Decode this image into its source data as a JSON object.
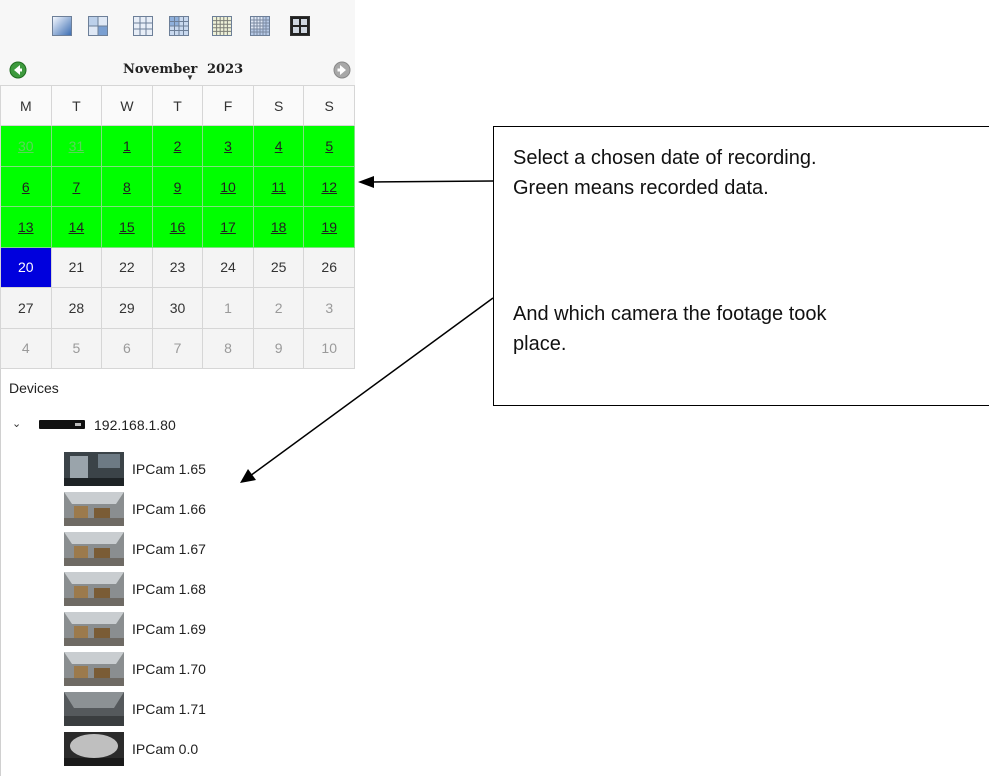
{
  "layout_buttons": [
    {
      "name": "layout-1x1"
    },
    {
      "name": "layout-2x2"
    },
    {
      "name": "layout-3x3"
    },
    {
      "name": "layout-4x4"
    },
    {
      "name": "layout-5x5"
    },
    {
      "name": "layout-6x6"
    },
    {
      "name": "layout-custom"
    }
  ],
  "calendar": {
    "month": "November",
    "year": "2023",
    "weekdays": [
      "M",
      "T",
      "W",
      "T",
      "F",
      "S",
      "S"
    ],
    "weeks": [
      [
        {
          "d": "30",
          "rec": true,
          "other": true
        },
        {
          "d": "31",
          "rec": true,
          "other": true
        },
        {
          "d": "1",
          "rec": true
        },
        {
          "d": "2",
          "rec": true
        },
        {
          "d": "3",
          "rec": true
        },
        {
          "d": "4",
          "rec": true
        },
        {
          "d": "5",
          "rec": true
        }
      ],
      [
        {
          "d": "6",
          "rec": true
        },
        {
          "d": "7",
          "rec": true
        },
        {
          "d": "8",
          "rec": true
        },
        {
          "d": "9",
          "rec": true
        },
        {
          "d": "10",
          "rec": true
        },
        {
          "d": "11",
          "rec": true
        },
        {
          "d": "12",
          "rec": true
        }
      ],
      [
        {
          "d": "13",
          "rec": true
        },
        {
          "d": "14",
          "rec": true
        },
        {
          "d": "15",
          "rec": true
        },
        {
          "d": "16",
          "rec": true
        },
        {
          "d": "17",
          "rec": true
        },
        {
          "d": "18",
          "rec": true
        },
        {
          "d": "19",
          "rec": true
        }
      ],
      [
        {
          "d": "20",
          "sel": true
        },
        {
          "d": "21"
        },
        {
          "d": "22"
        },
        {
          "d": "23"
        },
        {
          "d": "24"
        },
        {
          "d": "25"
        },
        {
          "d": "26"
        }
      ],
      [
        {
          "d": "27"
        },
        {
          "d": "28"
        },
        {
          "d": "29"
        },
        {
          "d": "30"
        },
        {
          "d": "1",
          "other": true
        },
        {
          "d": "2",
          "other": true
        },
        {
          "d": "3",
          "other": true
        }
      ],
      [
        {
          "d": "4",
          "other": true
        },
        {
          "d": "5",
          "other": true
        },
        {
          "d": "6",
          "other": true
        },
        {
          "d": "7",
          "other": true
        },
        {
          "d": "8",
          "other": true
        },
        {
          "d": "9",
          "other": true
        },
        {
          "d": "10",
          "other": true
        }
      ]
    ],
    "colors": {
      "recorded": "#00ff00",
      "selected": "#0000dd"
    }
  },
  "devices": {
    "title": "Devices",
    "recorder": {
      "label": "192.168.1.80",
      "expanded": true
    },
    "cameras": [
      {
        "label": "IPCam 1.65",
        "thumb": "dark"
      },
      {
        "label": "IPCam 1.66",
        "thumb": "warehouse"
      },
      {
        "label": "IPCam 1.67",
        "thumb": "warehouse"
      },
      {
        "label": "IPCam 1.68",
        "thumb": "warehouse"
      },
      {
        "label": "IPCam 1.69",
        "thumb": "warehouse"
      },
      {
        "label": "IPCam 1.70",
        "thumb": "warehouse"
      },
      {
        "label": "IPCam 1.71",
        "thumb": "gray"
      },
      {
        "label": "IPCam 0.0",
        "thumb": "night"
      }
    ]
  },
  "annotation": {
    "line1": "Select a chosen date of recording.",
    "line2": "Green means recorded data.",
    "line3": "And which camera the footage took",
    "line4": "place."
  }
}
